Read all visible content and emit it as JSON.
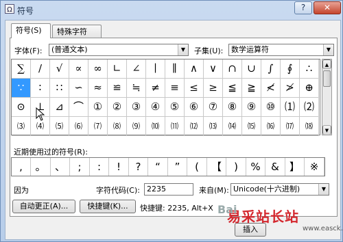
{
  "window": {
    "title": "符号",
    "help_label": "?",
    "close_label": "✕",
    "icon": "symbol-app-icon"
  },
  "tabs": [
    {
      "label": "符号(S)"
    },
    {
      "label": "特殊字符(P)"
    }
  ],
  "font": {
    "label": "字体(F):",
    "value": "(普通文本)"
  },
  "subset": {
    "label": "子集(U):",
    "value": "数学运算符"
  },
  "symbols": {
    "rows": [
      [
        "∑",
        "/",
        "√",
        "∝",
        "∞",
        "∟",
        "∠",
        "∣",
        "∥",
        "∧",
        "∨",
        "∩",
        "∪",
        "∫",
        "∮",
        "∴"
      ],
      [
        "∵",
        "∶",
        "∷",
        "∽",
        "≈",
        "≌",
        "≒",
        "≠",
        "≡",
        "≤",
        "≥",
        "≦",
        "≧",
        "≮",
        "≯",
        "⊕"
      ],
      [
        "⊙",
        "⊥",
        "⊿",
        "⌒",
        "①",
        "②",
        "③",
        "④",
        "⑤",
        "⑥",
        "⑦",
        "⑧",
        "⑨",
        "⑩",
        "⑴",
        "⑵"
      ],
      [
        "⑶",
        "⑷",
        "⑸",
        "⑹",
        "⑺",
        "⑻",
        "⑼",
        "⑽",
        "⑾",
        "⑿",
        "⒀",
        "⒁",
        "⒂",
        "⒃",
        "⒄",
        "⒅"
      ]
    ],
    "selected": "∵"
  },
  "recent": {
    "label": "近期使用过的符号(R):",
    "items": [
      ",",
      "。",
      "、",
      ";",
      ":",
      "!",
      "?",
      "“",
      "”",
      "(",
      "【",
      ")",
      "%",
      "&",
      "】",
      "※"
    ]
  },
  "char_name": "因为",
  "char_code": {
    "label": "字符代码(C):",
    "value": "2235"
  },
  "from": {
    "label": "来自(M):",
    "value": "Unicode(十六进制)"
  },
  "autocorrect_button": "自动更正(A)...",
  "shortcut_key_button": "快捷键(K)...",
  "shortcut_info": "快捷键: 2235, Alt+X",
  "insert_button": "插入",
  "watermark": {
    "main": "易采站长站",
    "sub": "www.easck.com",
    "overlay": "Bai"
  }
}
